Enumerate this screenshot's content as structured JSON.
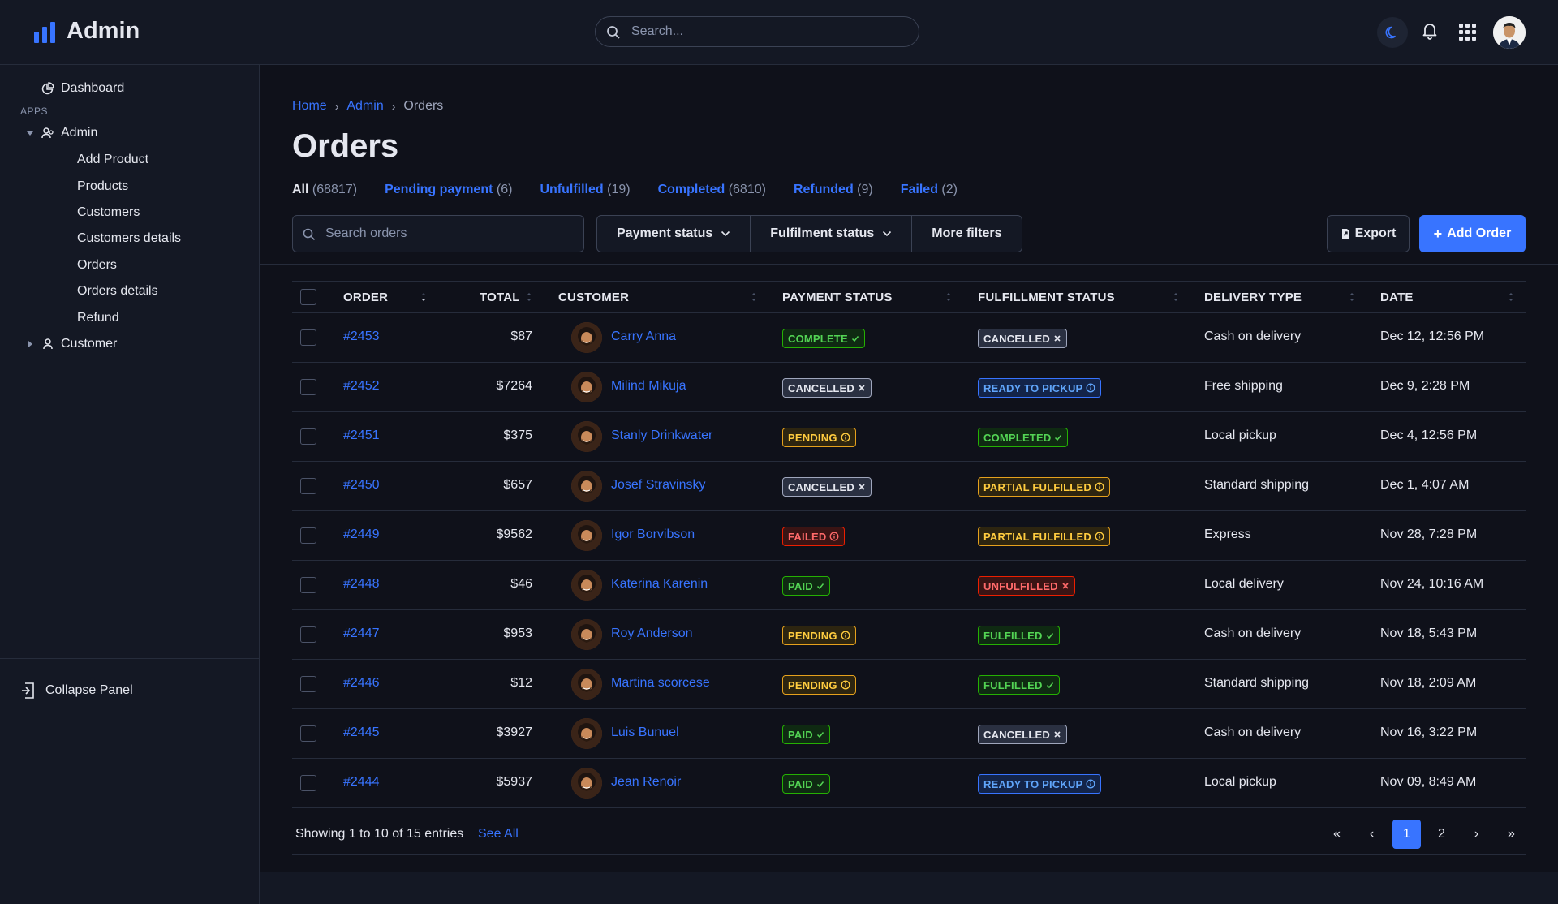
{
  "app": {
    "title": "Admin",
    "brand_color": "#3874ff"
  },
  "search": {
    "placeholder": "Search..."
  },
  "sidebar": {
    "dashboard": "Dashboard",
    "section_label": "APPS",
    "admin": "Admin",
    "admin_items": [
      "Add Product",
      "Products",
      "Customers",
      "Customers details",
      "Orders",
      "Orders details",
      "Refund"
    ],
    "customer": "Customer",
    "collapse": "Collapse Panel"
  },
  "breadcrumb": [
    "Home",
    "Admin",
    "Orders"
  ],
  "page": {
    "title": "Orders"
  },
  "tabs": [
    {
      "label": "All",
      "count": "(68817)"
    },
    {
      "label": "Pending payment",
      "count": "(6)"
    },
    {
      "label": "Unfulfilled",
      "count": "(19)"
    },
    {
      "label": "Completed",
      "count": "(6810)"
    },
    {
      "label": "Refunded",
      "count": "(9)"
    },
    {
      "label": "Failed",
      "count": "(2)"
    }
  ],
  "toolbar": {
    "search_placeholder": "Search orders",
    "payment_status": "Payment status",
    "fulfilment_status": "Fulfilment status",
    "more_filters": "More filters",
    "export": "Export",
    "add_order": "Add Order"
  },
  "table": {
    "headers": [
      "ORDER",
      "TOTAL",
      "CUSTOMER",
      "PAYMENT STATUS",
      "FULFILLMENT STATUS",
      "DELIVERY TYPE",
      "DATE"
    ],
    "rows": [
      {
        "order": "#2453",
        "total": "$87",
        "customer": "Carry Anna",
        "payment": "COMPLETE",
        "payment_kind": "green",
        "payment_icon": "check",
        "fulfillment": "CANCELLED",
        "fulfillment_kind": "gray",
        "fulfillment_icon": "x",
        "delivery": "Cash on delivery",
        "date": "Dec 12, 12:56 PM"
      },
      {
        "order": "#2452",
        "total": "$7264",
        "customer": "Milind Mikuja",
        "payment": "CANCELLED",
        "payment_kind": "gray",
        "payment_icon": "x",
        "fulfillment": "READY TO PICKUP",
        "fulfillment_kind": "blue",
        "fulfillment_icon": "info",
        "delivery": "Free shipping",
        "date": "Dec 9, 2:28 PM"
      },
      {
        "order": "#2451",
        "total": "$375",
        "customer": "Stanly Drinkwater",
        "payment": "PENDING",
        "payment_kind": "yellow",
        "payment_icon": "info",
        "fulfillment": "COMPLETED",
        "fulfillment_kind": "green",
        "fulfillment_icon": "check",
        "delivery": "Local pickup",
        "date": "Dec 4, 12:56 PM"
      },
      {
        "order": "#2450",
        "total": "$657",
        "customer": "Josef Stravinsky",
        "payment": "CANCELLED",
        "payment_kind": "gray",
        "payment_icon": "x",
        "fulfillment": "PARTIAL FULFILLED",
        "fulfillment_kind": "yellow",
        "fulfillment_icon": "info",
        "delivery": "Standard shipping",
        "date": "Dec 1, 4:07 AM"
      },
      {
        "order": "#2449",
        "total": "$9562",
        "customer": "Igor Borvibson",
        "payment": "FAILED",
        "payment_kind": "red",
        "payment_icon": "info",
        "fulfillment": "PARTIAL FULFILLED",
        "fulfillment_kind": "yellow",
        "fulfillment_icon": "info",
        "delivery": "Express",
        "date": "Nov 28, 7:28 PM"
      },
      {
        "order": "#2448",
        "total": "$46",
        "customer": "Katerina Karenin",
        "payment": "PAID",
        "payment_kind": "green",
        "payment_icon": "check",
        "fulfillment": "UNFULFILLED",
        "fulfillment_kind": "red",
        "fulfillment_icon": "x",
        "delivery": "Local delivery",
        "date": "Nov 24, 10:16 AM"
      },
      {
        "order": "#2447",
        "total": "$953",
        "customer": "Roy Anderson",
        "payment": "PENDING",
        "payment_kind": "yellow",
        "payment_icon": "info",
        "fulfillment": "FULFILLED",
        "fulfillment_kind": "green",
        "fulfillment_icon": "check",
        "delivery": "Cash on delivery",
        "date": "Nov 18, 5:43 PM"
      },
      {
        "order": "#2446",
        "total": "$12",
        "customer": "Martina scorcese",
        "payment": "PENDING",
        "payment_kind": "yellow",
        "payment_icon": "info",
        "fulfillment": "FULFILLED",
        "fulfillment_kind": "green",
        "fulfillment_icon": "check",
        "delivery": "Standard shipping",
        "date": "Nov 18, 2:09 AM"
      },
      {
        "order": "#2445",
        "total": "$3927",
        "customer": "Luis Bunuel",
        "payment": "PAID",
        "payment_kind": "green",
        "payment_icon": "check",
        "fulfillment": "CANCELLED",
        "fulfillment_kind": "gray",
        "fulfillment_icon": "x",
        "delivery": "Cash on delivery",
        "date": "Nov 16, 3:22 PM"
      },
      {
        "order": "#2444",
        "total": "$5937",
        "customer": "Jean Renoir",
        "payment": "PAID",
        "payment_kind": "green",
        "payment_icon": "check",
        "fulfillment": "READY TO PICKUP",
        "fulfillment_kind": "blue",
        "fulfillment_icon": "info",
        "delivery": "Local pickup",
        "date": "Nov 09, 8:49 AM"
      }
    ]
  },
  "footer": {
    "showing": "Showing 1 to 10 of 15 entries",
    "see_all": "See All",
    "pages": [
      "«",
      "‹",
      "1",
      "2",
      "›",
      "»"
    ],
    "current_page": "1"
  }
}
